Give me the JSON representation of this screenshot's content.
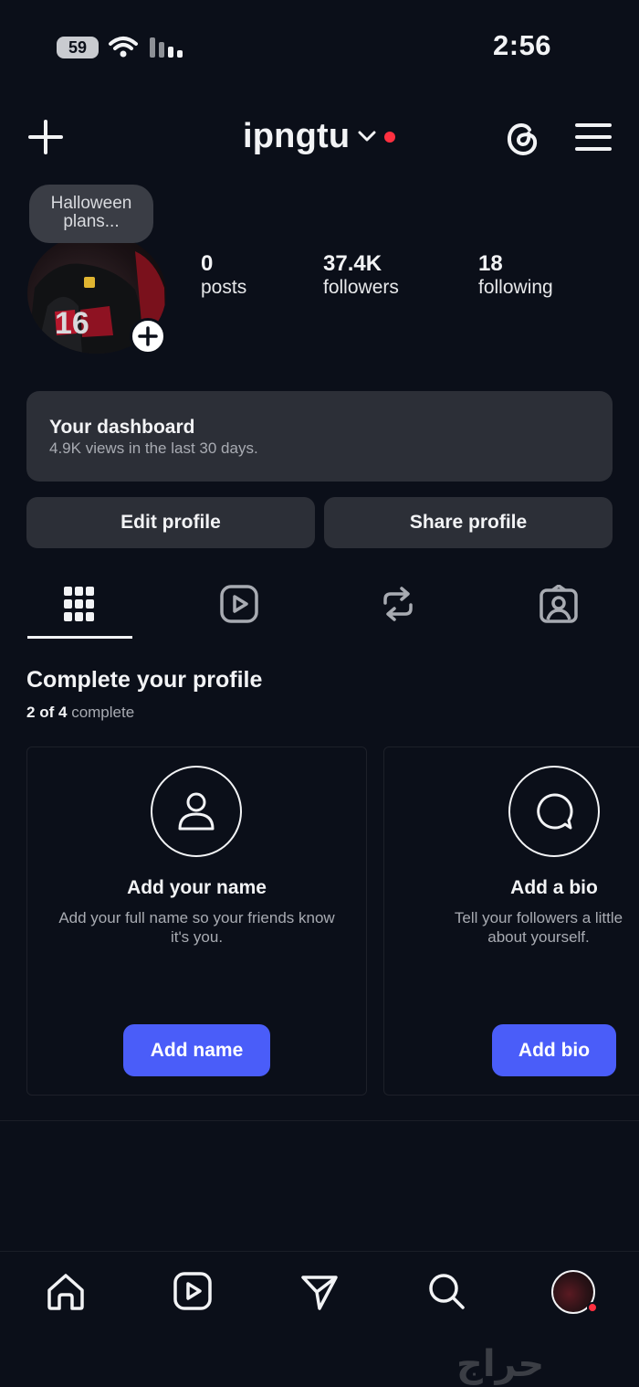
{
  "status_bar": {
    "time": "2:56",
    "battery": "59"
  },
  "header": {
    "username": "ipngtu"
  },
  "profile": {
    "note": "Halloween plans...",
    "stats": [
      {
        "value": "0",
        "label": "posts"
      },
      {
        "value": "37.4K",
        "label": "followers"
      },
      {
        "value": "18",
        "label": "following"
      }
    ]
  },
  "dashboard": {
    "title": "Your dashboard",
    "subtitle": "4.9K views in the last 30 days."
  },
  "actions": {
    "edit": "Edit profile",
    "share": "Share profile"
  },
  "tabs": [
    "grid",
    "reels",
    "reposts",
    "tagged"
  ],
  "complete_profile": {
    "title": "Complete your profile",
    "done": "2",
    "of": "of",
    "total": "4",
    "suffix": "complete",
    "cards": [
      {
        "title": "Add your name",
        "desc": "Add your full name so your friends know it's you.",
        "button": "Add name",
        "icon": "person-icon"
      },
      {
        "title": "Add a bio",
        "desc": "Tell your followers a little about yourself.",
        "button": "Add bio",
        "icon": "chat-bubble-icon"
      }
    ]
  },
  "bottom_nav": [
    "home",
    "reels",
    "messages",
    "search",
    "profile"
  ],
  "watermark": "حراج",
  "colors": {
    "background": "#0b0f19",
    "accent": "#4a5df9",
    "notification": "#ff3040",
    "surface": "#2c2f37"
  }
}
